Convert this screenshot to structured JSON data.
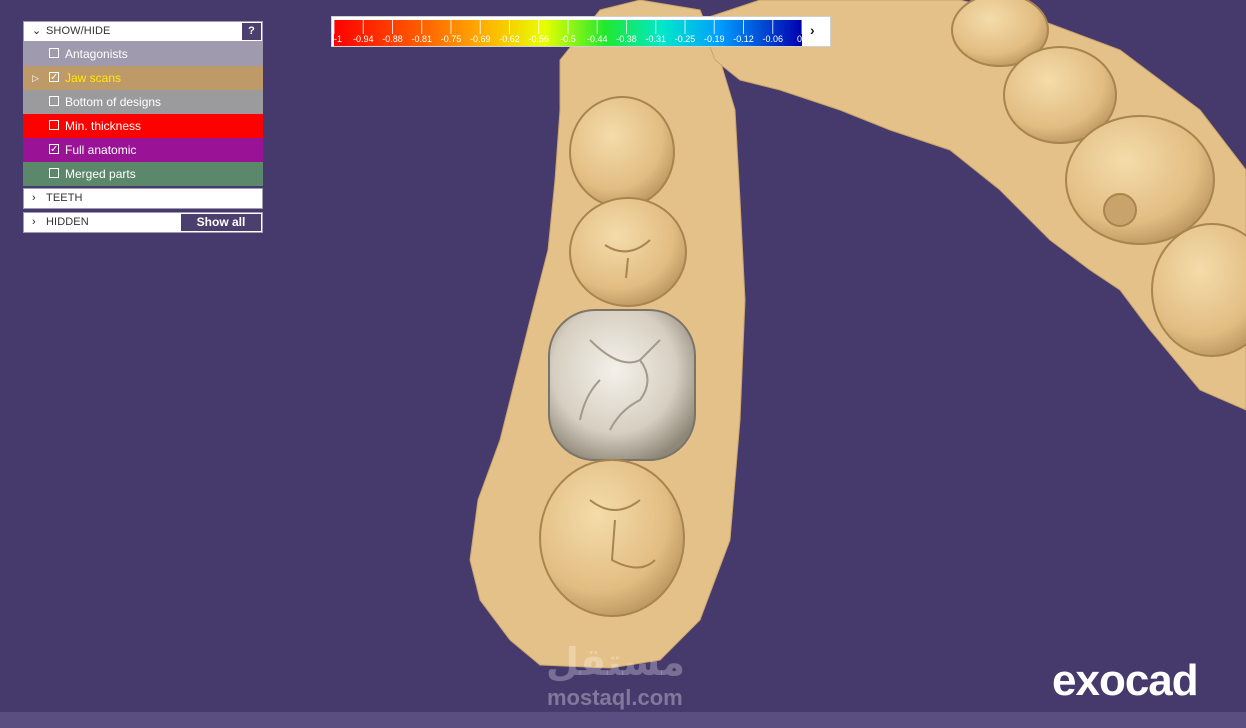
{
  "show_hide": {
    "title": "SHOW/HIDE",
    "help_label": "?",
    "items": [
      {
        "label": "Antagonists",
        "checked": false,
        "bg": "#9f9aae",
        "text_color": "#ffffff",
        "expander": false
      },
      {
        "label": "Jaw scans",
        "checked": true,
        "bg": "#bf9a69",
        "text_color": "#ffea00",
        "expander": true
      },
      {
        "label": "Bottom of designs",
        "checked": false,
        "bg": "#9b9a9d",
        "text_color": "#ffffff",
        "expander": false
      },
      {
        "label": "Min. thickness",
        "checked": false,
        "bg": "#fd0000",
        "text_color": "#ffffff",
        "expander": false
      },
      {
        "label": "Full anatomic",
        "checked": true,
        "bg": "#9a1296",
        "text_color": "#ffffff",
        "expander": false
      },
      {
        "label": "Merged parts",
        "checked": false,
        "bg": "#5b876a",
        "text_color": "#ffffff",
        "expander": false
      }
    ],
    "check_glyph": "✓"
  },
  "teeth": {
    "title": "TEETH"
  },
  "hidden": {
    "title": "HIDDEN",
    "show_all_label": "Show all"
  },
  "color_scale": {
    "labels": [
      "-1",
      "-0.94",
      "-0.88",
      "-0.81",
      "-0.75",
      "-0.69",
      "-0.62",
      "-0.56",
      "-0.5",
      "-0.44",
      "-0.38",
      "-0.31",
      "-0.25",
      "-0.19",
      "-0.12",
      "-0.06",
      "0"
    ],
    "next_glyph": "›"
  },
  "colors": {
    "background": "#46396c",
    "panel_button": "#4b3f6e",
    "tooth": "#e6c489",
    "crown": "#d8d2c6"
  },
  "icons": {
    "expand": "chevron-down-icon",
    "collapsed": "chevron-right-icon",
    "tree": "triangle-right-icon"
  },
  "logo": "exocad",
  "watermark": {
    "arabic": "مستقل",
    "latin": "mostaql.com"
  }
}
